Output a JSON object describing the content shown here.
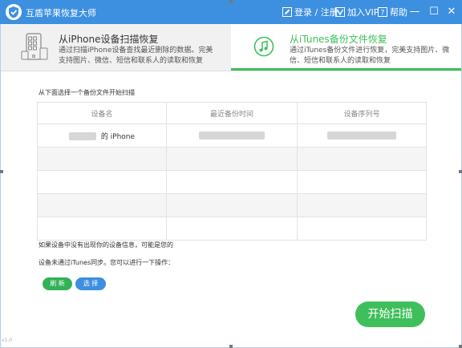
{
  "window": {
    "title": "互盾苹果恢复大师",
    "version": "v1.0"
  },
  "toolbar": {
    "login_label": "登录 / 注册",
    "vip_label": "加入VIP",
    "help_label": "帮助",
    "separator": "|",
    "minimize_glyph": "—",
    "maximize_glyph": "☐",
    "close_glyph": "✕"
  },
  "tabs": [
    {
      "title": "从iPhone设备扫描恢复",
      "desc": "通过扫描iPhone设备查找最近删除的数据。完美支持图片、微信、短信和联系人的读取和恢复",
      "icon": "phone-apps-icon",
      "active": false
    },
    {
      "title": "从iTunes备份文件恢复",
      "desc": "通过iTunes备份文件进行恢复，完美支持图片、微信、短信和联系人的读取和恢复",
      "icon": "music-note-icon",
      "active": true
    }
  ],
  "main": {
    "instruction": "从下面选择一个备份文件开始扫描",
    "table": {
      "headers": [
        "设备名",
        "最近备份时间",
        "设备序列号"
      ],
      "rows": [
        {
          "device_name": "的 iPhone"
        }
      ]
    },
    "hint_line1": "如果设备中没有出现你的设备信息，可能是您的",
    "hint_line2": "设备未通过iTunes同步。您可以进行一下操作：",
    "refresh_label": "刷 新",
    "select_label": "选 择",
    "start_scan_label": "开始扫描"
  },
  "colors": {
    "titlebar": "#3d8fe0",
    "accent_green": "#3fbf5b",
    "accent_blue": "#3d8fe0"
  }
}
